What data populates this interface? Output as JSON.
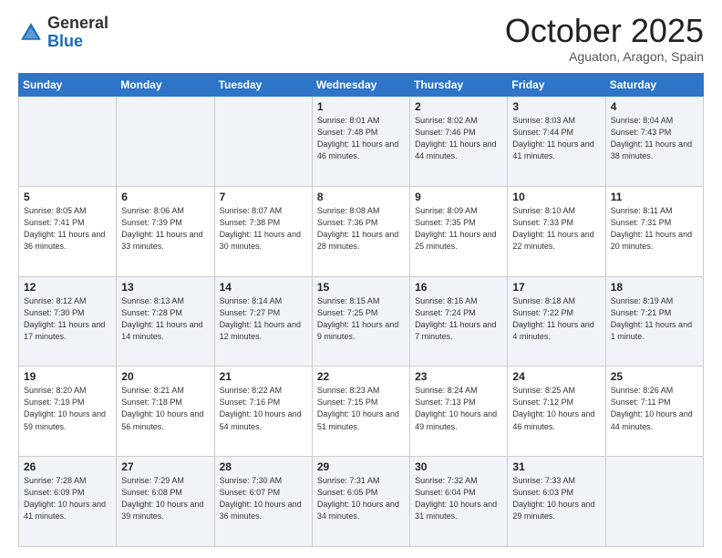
{
  "header": {
    "logo_general": "General",
    "logo_blue": "Blue",
    "month": "October 2025",
    "location": "Aguaton, Aragon, Spain"
  },
  "days_of_week": [
    "Sunday",
    "Monday",
    "Tuesday",
    "Wednesday",
    "Thursday",
    "Friday",
    "Saturday"
  ],
  "weeks": [
    [
      {
        "num": "",
        "info": ""
      },
      {
        "num": "",
        "info": ""
      },
      {
        "num": "",
        "info": ""
      },
      {
        "num": "1",
        "info": "Sunrise: 8:01 AM\nSunset: 7:48 PM\nDaylight: 11 hours\nand 46 minutes."
      },
      {
        "num": "2",
        "info": "Sunrise: 8:02 AM\nSunset: 7:46 PM\nDaylight: 11 hours\nand 44 minutes."
      },
      {
        "num": "3",
        "info": "Sunrise: 8:03 AM\nSunset: 7:44 PM\nDaylight: 11 hours\nand 41 minutes."
      },
      {
        "num": "4",
        "info": "Sunrise: 8:04 AM\nSunset: 7:43 PM\nDaylight: 11 hours\nand 38 minutes."
      }
    ],
    [
      {
        "num": "5",
        "info": "Sunrise: 8:05 AM\nSunset: 7:41 PM\nDaylight: 11 hours\nand 36 minutes."
      },
      {
        "num": "6",
        "info": "Sunrise: 8:06 AM\nSunset: 7:39 PM\nDaylight: 11 hours\nand 33 minutes."
      },
      {
        "num": "7",
        "info": "Sunrise: 8:07 AM\nSunset: 7:38 PM\nDaylight: 11 hours\nand 30 minutes."
      },
      {
        "num": "8",
        "info": "Sunrise: 8:08 AM\nSunset: 7:36 PM\nDaylight: 11 hours\nand 28 minutes."
      },
      {
        "num": "9",
        "info": "Sunrise: 8:09 AM\nSunset: 7:35 PM\nDaylight: 11 hours\nand 25 minutes."
      },
      {
        "num": "10",
        "info": "Sunrise: 8:10 AM\nSunset: 7:33 PM\nDaylight: 11 hours\nand 22 minutes."
      },
      {
        "num": "11",
        "info": "Sunrise: 8:11 AM\nSunset: 7:31 PM\nDaylight: 11 hours\nand 20 minutes."
      }
    ],
    [
      {
        "num": "12",
        "info": "Sunrise: 8:12 AM\nSunset: 7:30 PM\nDaylight: 11 hours\nand 17 minutes."
      },
      {
        "num": "13",
        "info": "Sunrise: 8:13 AM\nSunset: 7:28 PM\nDaylight: 11 hours\nand 14 minutes."
      },
      {
        "num": "14",
        "info": "Sunrise: 8:14 AM\nSunset: 7:27 PM\nDaylight: 11 hours\nand 12 minutes."
      },
      {
        "num": "15",
        "info": "Sunrise: 8:15 AM\nSunset: 7:25 PM\nDaylight: 11 hours\nand 9 minutes."
      },
      {
        "num": "16",
        "info": "Sunrise: 8:16 AM\nSunset: 7:24 PM\nDaylight: 11 hours\nand 7 minutes."
      },
      {
        "num": "17",
        "info": "Sunrise: 8:18 AM\nSunset: 7:22 PM\nDaylight: 11 hours\nand 4 minutes."
      },
      {
        "num": "18",
        "info": "Sunrise: 8:19 AM\nSunset: 7:21 PM\nDaylight: 11 hours\nand 1 minute."
      }
    ],
    [
      {
        "num": "19",
        "info": "Sunrise: 8:20 AM\nSunset: 7:19 PM\nDaylight: 10 hours\nand 59 minutes."
      },
      {
        "num": "20",
        "info": "Sunrise: 8:21 AM\nSunset: 7:18 PM\nDaylight: 10 hours\nand 56 minutes."
      },
      {
        "num": "21",
        "info": "Sunrise: 8:22 AM\nSunset: 7:16 PM\nDaylight: 10 hours\nand 54 minutes."
      },
      {
        "num": "22",
        "info": "Sunrise: 8:23 AM\nSunset: 7:15 PM\nDaylight: 10 hours\nand 51 minutes."
      },
      {
        "num": "23",
        "info": "Sunrise: 8:24 AM\nSunset: 7:13 PM\nDaylight: 10 hours\nand 49 minutes."
      },
      {
        "num": "24",
        "info": "Sunrise: 8:25 AM\nSunset: 7:12 PM\nDaylight: 10 hours\nand 46 minutes."
      },
      {
        "num": "25",
        "info": "Sunrise: 8:26 AM\nSunset: 7:11 PM\nDaylight: 10 hours\nand 44 minutes."
      }
    ],
    [
      {
        "num": "26",
        "info": "Sunrise: 7:28 AM\nSunset: 6:09 PM\nDaylight: 10 hours\nand 41 minutes."
      },
      {
        "num": "27",
        "info": "Sunrise: 7:29 AM\nSunset: 6:08 PM\nDaylight: 10 hours\nand 39 minutes."
      },
      {
        "num": "28",
        "info": "Sunrise: 7:30 AM\nSunset: 6:07 PM\nDaylight: 10 hours\nand 36 minutes."
      },
      {
        "num": "29",
        "info": "Sunrise: 7:31 AM\nSunset: 6:05 PM\nDaylight: 10 hours\nand 34 minutes."
      },
      {
        "num": "30",
        "info": "Sunrise: 7:32 AM\nSunset: 6:04 PM\nDaylight: 10 hours\nand 31 minutes."
      },
      {
        "num": "31",
        "info": "Sunrise: 7:33 AM\nSunset: 6:03 PM\nDaylight: 10 hours\nand 29 minutes."
      },
      {
        "num": "",
        "info": ""
      }
    ]
  ]
}
